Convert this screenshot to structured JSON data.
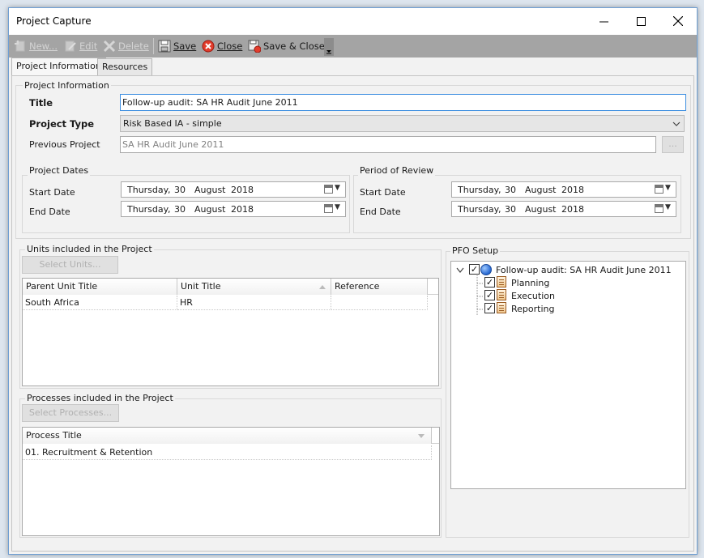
{
  "window": {
    "title": "Project Capture"
  },
  "toolbar": {
    "new_label": "New...",
    "edit_label": "Edit",
    "delete_label": "Delete",
    "save_label": "Save",
    "close_label": "Close",
    "save_close_label": "Save & Close"
  },
  "tabs": [
    {
      "label": "Project Information"
    },
    {
      "label": "Resources"
    }
  ],
  "project_info": {
    "group_label": "Project Information",
    "title_label": "Title",
    "title_value": "Follow-up audit: SA HR Audit June 2011",
    "type_label": "Project Type",
    "type_value": "Risk Based IA - simple",
    "previous_label": "Previous Project",
    "previous_value": "SA HR Audit June 2011",
    "browse_label": "..."
  },
  "project_dates": {
    "group_label": "Project Dates",
    "start_label": "Start Date",
    "end_label": "End Date",
    "start": {
      "weekday": "Thursday",
      "sep": ",",
      "day": "30",
      "month": "August",
      "year": "2018"
    },
    "end": {
      "weekday": "Thursday",
      "sep": ",",
      "day": "30",
      "month": "August",
      "year": "2018"
    }
  },
  "review_period": {
    "group_label": "Period of Review",
    "start_label": "Start Date",
    "end_label": "End Date",
    "start": {
      "weekday": "Thursday",
      "sep": ",",
      "day": "30",
      "month": "August",
      "year": "2018"
    },
    "end": {
      "weekday": "Thursday",
      "sep": ",",
      "day": "30",
      "month": "August",
      "year": "2018"
    }
  },
  "units": {
    "group_label": "Units included in the Project",
    "select_button": "Select Units...",
    "columns": [
      "Parent Unit Title",
      "Unit Title",
      "Reference"
    ],
    "rows": [
      [
        "South Africa",
        "HR",
        ""
      ]
    ]
  },
  "processes": {
    "group_label": "Processes included in the Project",
    "select_button": "Select Processes...",
    "columns": [
      "Process Title"
    ],
    "rows": [
      [
        "01. Recruitment & Retention"
      ]
    ]
  },
  "pfo": {
    "group_label": "PFO Setup",
    "root": "Follow-up audit: SA HR Audit June 2011",
    "children": [
      "Planning",
      "Execution",
      "Reporting"
    ]
  }
}
